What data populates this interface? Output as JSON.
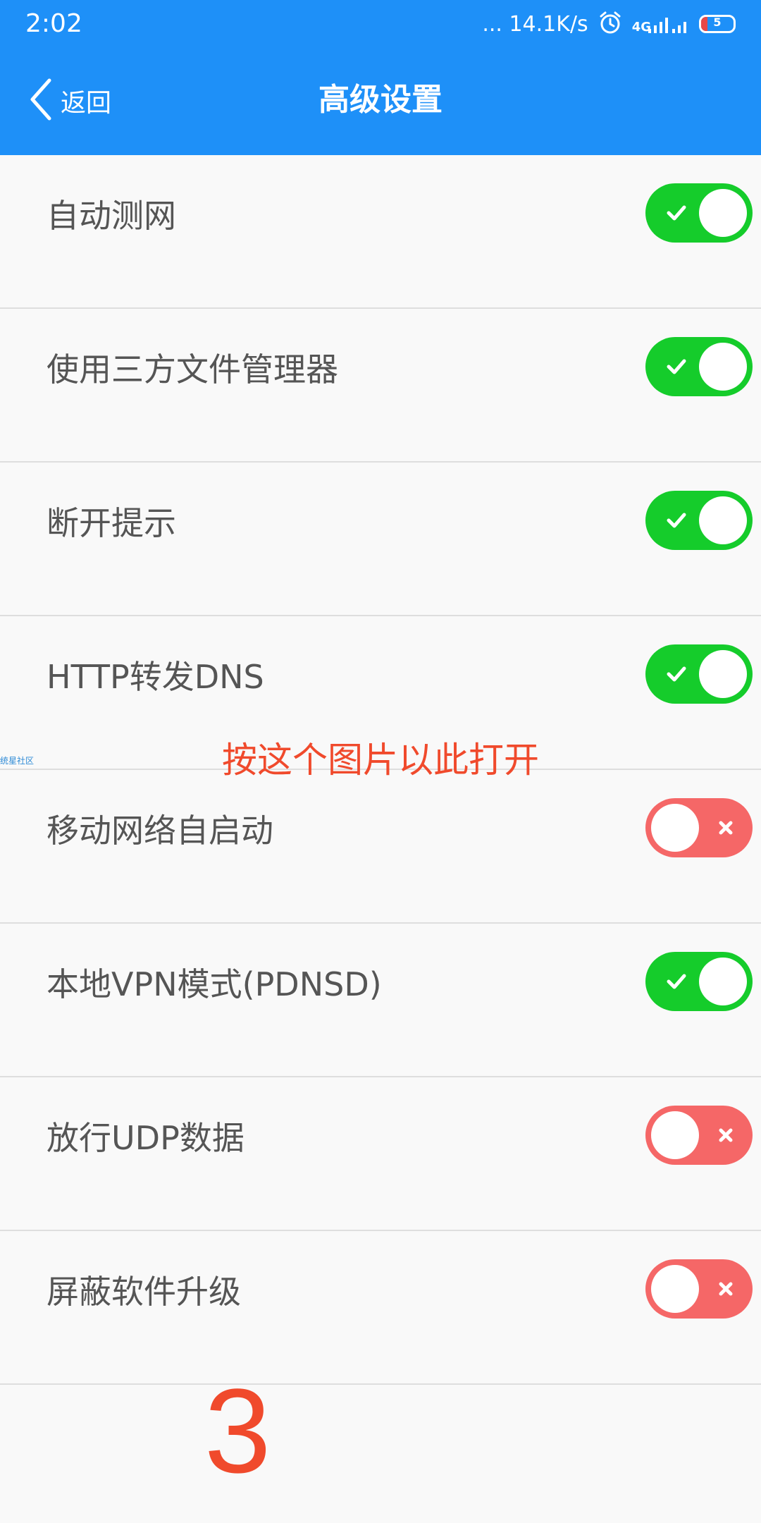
{
  "status_bar": {
    "time": "2:02",
    "network_speed": "... 14.1K/s",
    "network_type": "4G",
    "battery_level": "5",
    "battery_fraction": 0.05,
    "icons": [
      "alarm-icon",
      "signal-icon",
      "battery-icon"
    ]
  },
  "header": {
    "back_label": "返回",
    "title": "高级设置",
    "background_color": "#1e90f8"
  },
  "settings": [
    {
      "label": "自动测网",
      "enabled": true
    },
    {
      "label": "使用三方文件管理器",
      "enabled": true
    },
    {
      "label": "断开提示",
      "enabled": true
    },
    {
      "label": "HTTP转发DNS",
      "enabled": true
    },
    {
      "label": "移动网络自启动",
      "enabled": false
    },
    {
      "label": "本地VPN模式(PDNSD)",
      "enabled": true
    },
    {
      "label": "放行UDP数据",
      "enabled": false
    },
    {
      "label": "屏蔽软件升级",
      "enabled": false
    }
  ],
  "colors": {
    "toggle_on": "#15cc2b",
    "toggle_off": "#f56767",
    "annotation": "#f04a2c"
  },
  "annotations": {
    "instruction": "按这个图片以此打开",
    "number": "3",
    "watermark": "统星社区"
  }
}
